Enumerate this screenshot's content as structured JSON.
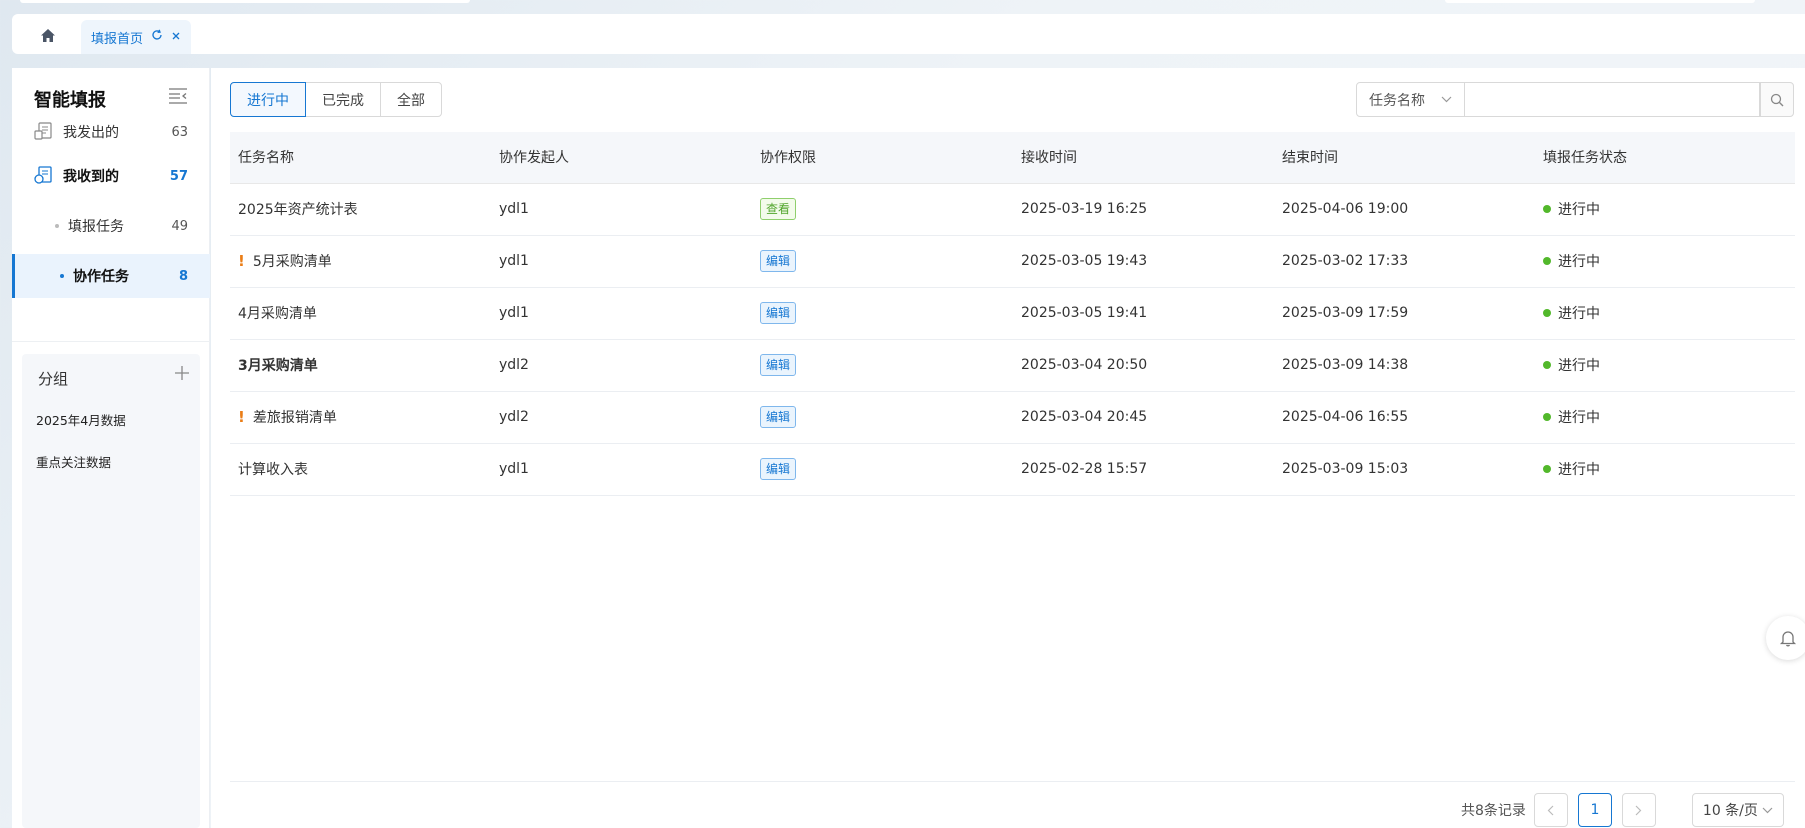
{
  "tabs": {
    "home_icon": "home-icon",
    "active_tab": "填报首页"
  },
  "sidebar": {
    "title": "智能填报",
    "items": [
      {
        "label": "我发出的",
        "count": "63"
      },
      {
        "label": "我收到的",
        "count": "57"
      },
      {
        "label": "填报任务",
        "count": "49"
      },
      {
        "label": "协作任务",
        "count": "8"
      }
    ],
    "group_title": "分组",
    "groups": [
      "2025年4月数据",
      "重点关注数据"
    ]
  },
  "filter": {
    "segments": [
      "进行中",
      "已完成",
      "全部"
    ],
    "active_segment": "进行中",
    "search_field": "任务名称",
    "search_placeholder": ""
  },
  "table": {
    "columns": [
      "任务名称",
      "协作发起人",
      "协作权限",
      "接收时间",
      "结束时间",
      "填报任务状态"
    ],
    "rows": [
      {
        "name": "2025年资产统计表",
        "warn": false,
        "bold": false,
        "owner": "ydl1",
        "perm": "查看",
        "perm_type": "view",
        "received": "2025-03-19 16:25",
        "end": "2025-04-06 19:00",
        "status": "进行中"
      },
      {
        "name": "5月采购清单",
        "warn": true,
        "bold": false,
        "owner": "ydl1",
        "perm": "编辑",
        "perm_type": "edit",
        "received": "2025-03-05 19:43",
        "end": "2025-03-02 17:33",
        "status": "进行中"
      },
      {
        "name": "4月采购清单",
        "warn": false,
        "bold": false,
        "owner": "ydl1",
        "perm": "编辑",
        "perm_type": "edit",
        "received": "2025-03-05 19:41",
        "end": "2025-03-09 17:59",
        "status": "进行中"
      },
      {
        "name": "3月采购清单",
        "warn": false,
        "bold": true,
        "owner": "ydl2",
        "perm": "编辑",
        "perm_type": "edit",
        "received": "2025-03-04 20:50",
        "end": "2025-03-09 14:38",
        "status": "进行中"
      },
      {
        "name": "差旅报销清单",
        "warn": true,
        "bold": false,
        "owner": "ydl2",
        "perm": "编辑",
        "perm_type": "edit",
        "received": "2025-03-04 20:45",
        "end": "2025-04-06 16:55",
        "status": "进行中"
      },
      {
        "name": "计算收入表",
        "warn": false,
        "bold": false,
        "owner": "ydl1",
        "perm": "编辑",
        "perm_type": "edit",
        "received": "2025-02-28 15:57",
        "end": "2025-03-09 15:03",
        "status": "进行中"
      }
    ]
  },
  "pagination": {
    "total": "共8条记录",
    "current_page": "1",
    "page_size": "10 条/页"
  },
  "colors": {
    "accent": "#1677d2",
    "status_running": "#52b82b",
    "warn": "#ea7d16"
  }
}
